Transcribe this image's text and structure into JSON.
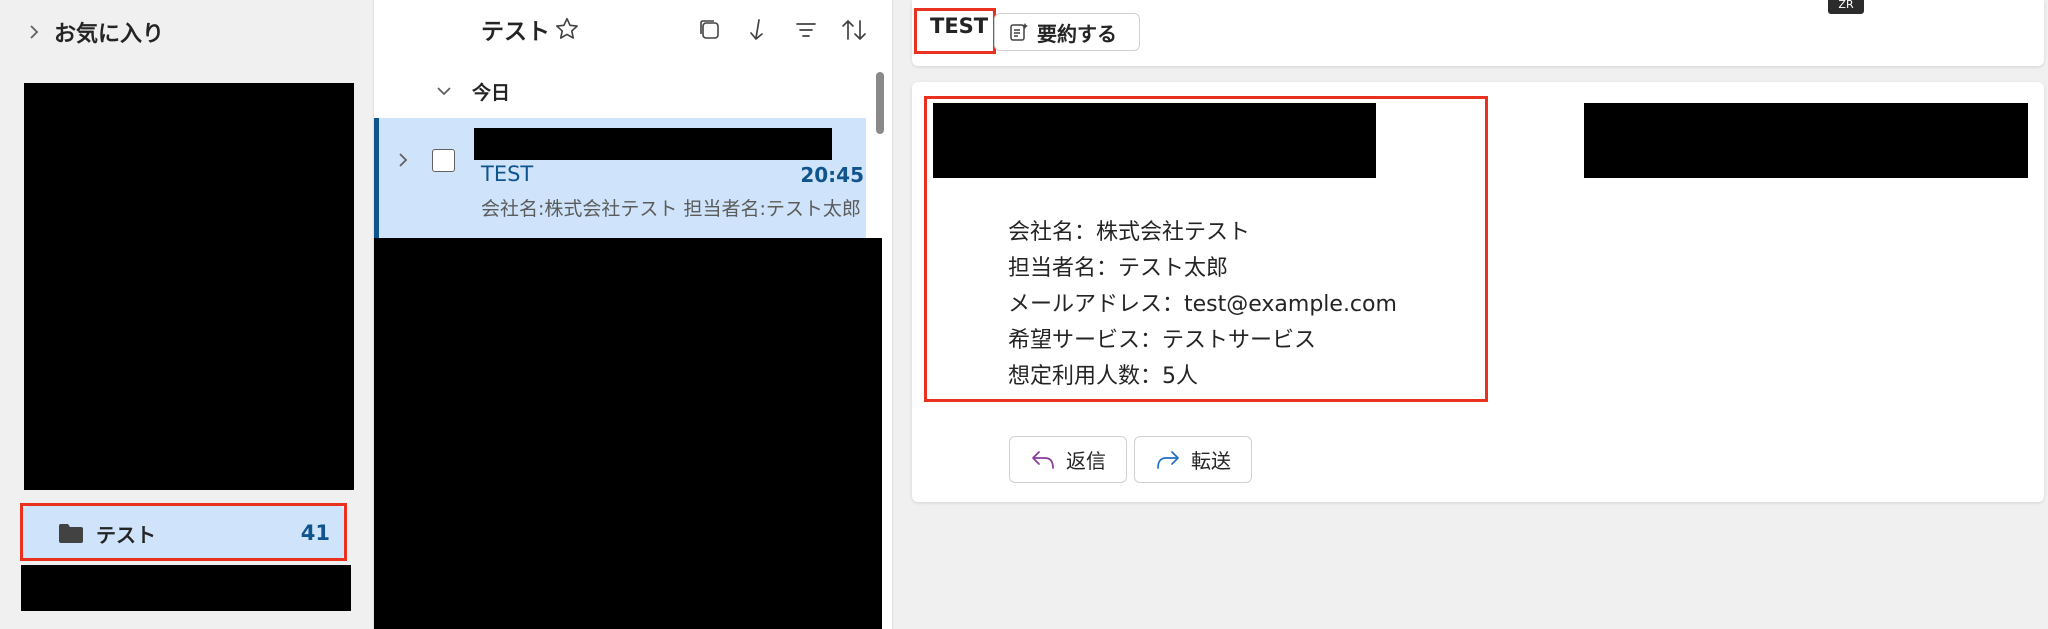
{
  "sidebar": {
    "favorites_label": "お気に入り",
    "folder": {
      "label": "テスト",
      "count": "41"
    }
  },
  "list": {
    "title": "テスト",
    "group_label": "今日",
    "message": {
      "sender": "TEST",
      "time": "20:45",
      "preview": "会社名:株式会社テスト 担当者名:テスト太郎"
    }
  },
  "reading": {
    "tag": "TEST",
    "summarize_label": "要約する",
    "shortcut_label": "ZR",
    "body_lines": [
      "会社名：株式会社テスト",
      "担当者名：テスト太郎",
      "メールアドレス：test@example.com",
      "希望サービス：テストサービス",
      "想定利用人数：5人"
    ],
    "reply_label": "返信",
    "forward_label": "転送"
  },
  "colors": {
    "accent": "#0f548c",
    "selected_bg": "#cfe4fa",
    "highlight_border": "#e8321f"
  }
}
